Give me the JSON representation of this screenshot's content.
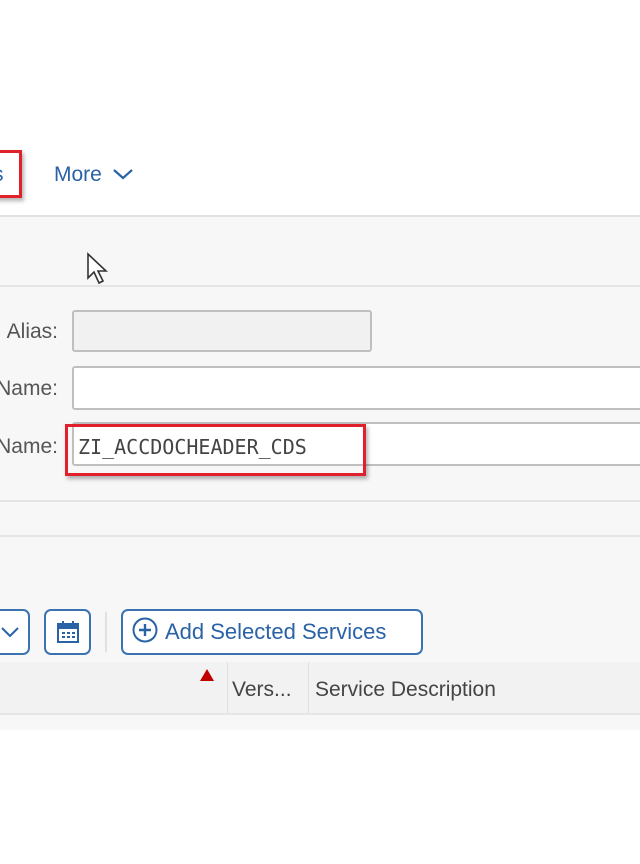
{
  "toolbar_top": {
    "partial_button_label": "s",
    "more_label": "More"
  },
  "form": {
    "alias_label": "Alias:",
    "alias_value": "",
    "name_label": "Name:",
    "name_value": "",
    "tech_name_label": "Name:",
    "tech_name_value": "ZI_ACCDOCHEADER_CDS"
  },
  "table_toolbar": {
    "add_selected_label": "Add Selected Services"
  },
  "table": {
    "columns": [
      "",
      "Vers...",
      "Service Description"
    ]
  },
  "colors": {
    "accent": "#2a62a6",
    "highlight": "#e0202a",
    "sort_indicator": "#c00000"
  }
}
